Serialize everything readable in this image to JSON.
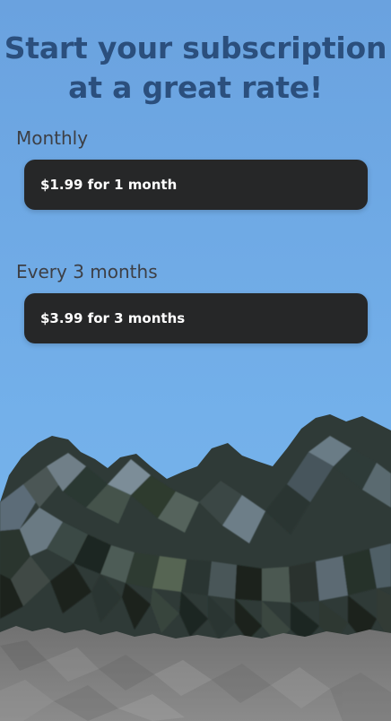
{
  "page": {
    "title_line_1": "Start your subscription",
    "title_line_2": "at a great rate!"
  },
  "plans": [
    {
      "label": "Monthly",
      "button_label": "$1.99 for 1 month"
    },
    {
      "label": "Every 3 months",
      "button_label": "$3.99 for 3 months"
    }
  ],
  "colors": {
    "sky_top": "#6aa2df",
    "sky_bottom": "#74b2ea",
    "title": "#2b4f7d",
    "button_bg": "#262728",
    "button_text": "#ffffff",
    "label_text": "#3d3f45",
    "ground": "#7d7d7d",
    "foliage_dark": "#1f2823",
    "foliage_light": "#5e7080"
  }
}
